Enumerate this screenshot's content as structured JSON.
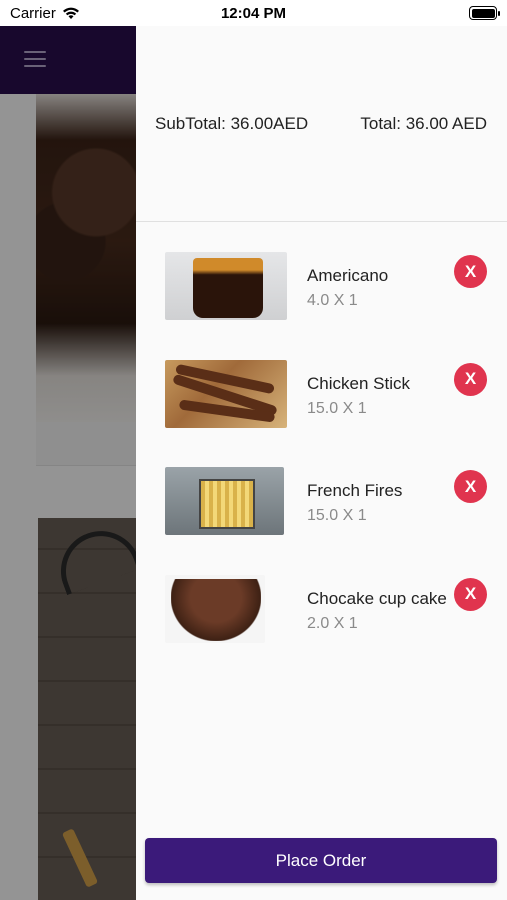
{
  "status_bar": {
    "carrier": "Carrier",
    "time": "12:04 PM",
    "wifi_icon": "wifi-icon",
    "battery_icon": "battery-icon"
  },
  "header": {
    "menu_icon": "hamburger-menu-icon",
    "color": "#2a0f4f"
  },
  "cart": {
    "subtotal": "SubTotal: 36.00AED",
    "total": "Total: 36.00 AED",
    "items": [
      {
        "name": "Americano",
        "qty": "4.0 X 1",
        "remove_label": "X"
      },
      {
        "name": "Chicken Stick",
        "qty": "15.0 X 1",
        "remove_label": "X"
      },
      {
        "name": "French Fires",
        "qty": "15.0 X 1",
        "remove_label": "X"
      },
      {
        "name": "Chocake cup cake",
        "qty": "2.0 X 1",
        "remove_label": "X"
      }
    ],
    "place_order_label": "Place Order"
  },
  "colors": {
    "accent": "#3b1a7a",
    "remove": "#e0344e",
    "header": "#2a0f4f"
  }
}
